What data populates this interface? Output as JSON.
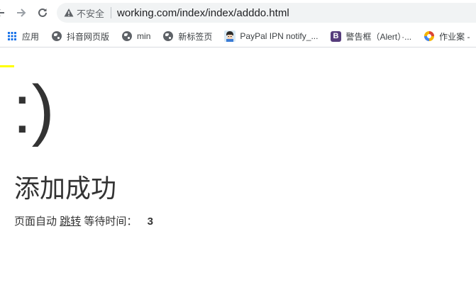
{
  "browser": {
    "security_label": "不安全",
    "url": "working.com/index/index/adddo.html"
  },
  "bookmarks": [
    {
      "label": "应用",
      "icon": "apps-grid-icon"
    },
    {
      "label": "抖音网页版",
      "icon": "globe-icon"
    },
    {
      "label": "min",
      "icon": "globe-icon"
    },
    {
      "label": "新标签页",
      "icon": "globe-icon"
    },
    {
      "label": "PayPal IPN notify_...",
      "icon": "avatar-icon"
    },
    {
      "label": "警告框（Alert）·...",
      "icon": "bootstrap-icon"
    },
    {
      "label": "作业案 -",
      "icon": "colorful-logo-icon"
    }
  ],
  "page": {
    "smiley": ":)",
    "title": "添加成功",
    "jump_prefix": "页面自动",
    "jump_link": "跳转",
    "wait_label": "等待时间：",
    "wait_seconds": "3",
    "accent_color": "#ffff00"
  }
}
